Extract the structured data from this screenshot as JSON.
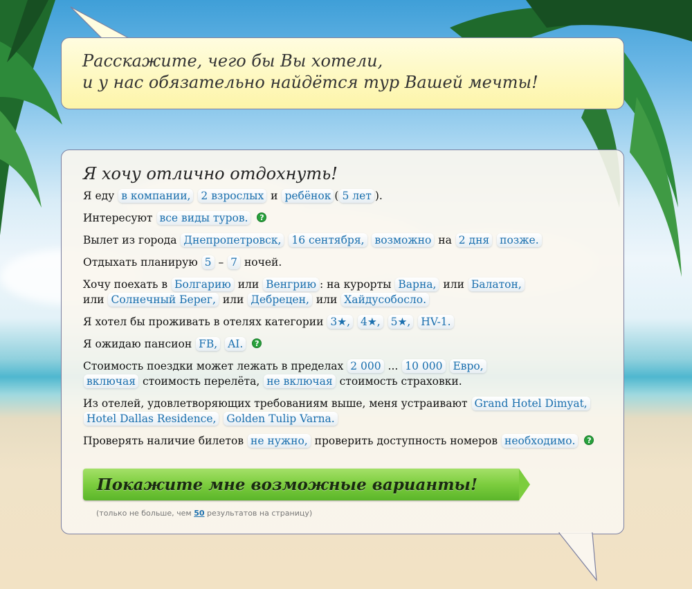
{
  "intro": {
    "line1": "Расскажите, чего бы Вы хотели,",
    "line2": "и у нас обязательно найдётся тур Вашей мечты!"
  },
  "form": {
    "title": "Я хочу отлично отдохнуть!",
    "row1": {
      "pre": "Я еду",
      "company": "в компании,",
      "adults": "2 взрослых",
      "and": "и",
      "child": "ребёнок",
      "open": "(",
      "age": "5 лет",
      "close": ")."
    },
    "row2": {
      "pre": "Интересуют",
      "types": "все виды туров."
    },
    "row3": {
      "pre": "Вылет из города",
      "city": "Днепропетровск,",
      "date": "16 сентября,",
      "flex": "возможно",
      "on": "на",
      "days": "2 дня",
      "later": "позже."
    },
    "row4": {
      "pre": "Отдыхать планирую",
      "from": "5",
      "dash": "–",
      "to": "7",
      "post": "ночей."
    },
    "row5": {
      "pre": "Хочу поехать в",
      "country1": "Болгарию",
      "or1": "или",
      "country2": "Венгрию",
      "resorts": ": на курорты",
      "resort1": "Варна,",
      "or2": "или",
      "resort2": "Балатон,",
      "or3": "или",
      "resort3": "Солнечный Берег,",
      "or4": "или",
      "resort4": "Дебрецен,",
      "or5": "или",
      "resort5": "Хайдусобосло."
    },
    "row6": {
      "pre": "Я хотел бы проживать в отелях категории",
      "c1": "3★,",
      "c2": "4★,",
      "c3": "5★,",
      "c4": "HV-1."
    },
    "row7": {
      "pre": "Я ожидаю пансион",
      "b1": "FB,",
      "b2": "AI."
    },
    "row8": {
      "pre": "Стоимость поездки может лежать в пределах",
      "min": "2 000",
      "dots": "...",
      "max": "10 000",
      "currency": "Евро,",
      "incl": "включая",
      "flight": "стоимость перелёта,",
      "notincl": "не включая",
      "insurance": "стоимость страховки."
    },
    "row9": {
      "pre": "Из отелей, удовлетворяющих требованиям выше, меня устраивают",
      "h1": "Grand Hotel Dimyat,",
      "h2": "Hotel Dallas Residence,",
      "h3": "Golden Tulip Varna."
    },
    "row10": {
      "pre": "Проверять наличие билетов",
      "tickets": "не нужно,",
      "mid": "проверить доступность номеров",
      "rooms": "необходимо."
    },
    "help_icon": "?",
    "cta": "Покажите мне возможные варианты!",
    "note_pre": "(только не больше, чем",
    "note_count": "50",
    "note_post": "результатов на страницу)"
  }
}
